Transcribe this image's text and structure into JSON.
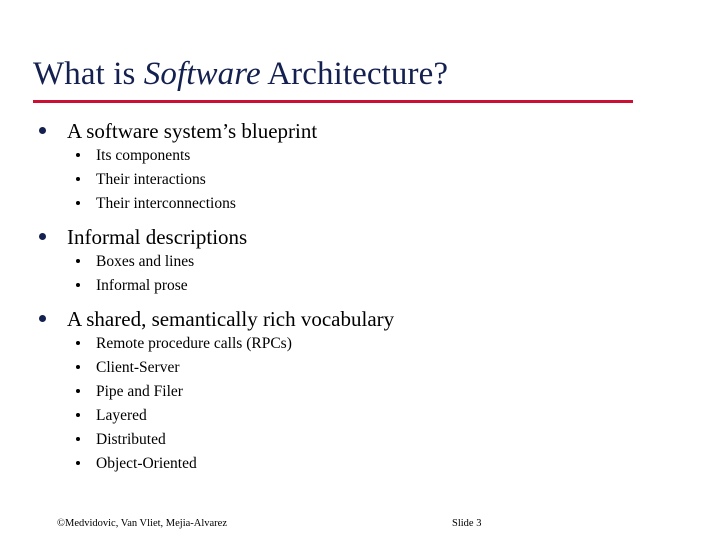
{
  "slide": {
    "title": {
      "before_italic": "What is ",
      "italic": "Software",
      "after_italic": " Architecture?"
    },
    "accent_color": "#cc1033",
    "title_color": "#14204f",
    "groups": [
      {
        "heading": "A software system’s blueprint",
        "sub_items": [
          "Its components",
          "Their interactions",
          "Their interconnections"
        ]
      },
      {
        "heading": "Informal descriptions",
        "sub_items": [
          "Boxes and lines",
          "Informal prose"
        ]
      },
      {
        "heading": "A shared, semantically rich vocabulary",
        "sub_items": [
          "Remote procedure calls (RPCs)",
          "Client-Server",
          "Pipe and Filer",
          "Layered",
          "Distributed",
          "Object-Oriented"
        ]
      }
    ],
    "footer": {
      "copyright": "©Medvidovic, Van Vliet, Mejia-Alvarez",
      "slide_number": "Slide 3"
    }
  }
}
